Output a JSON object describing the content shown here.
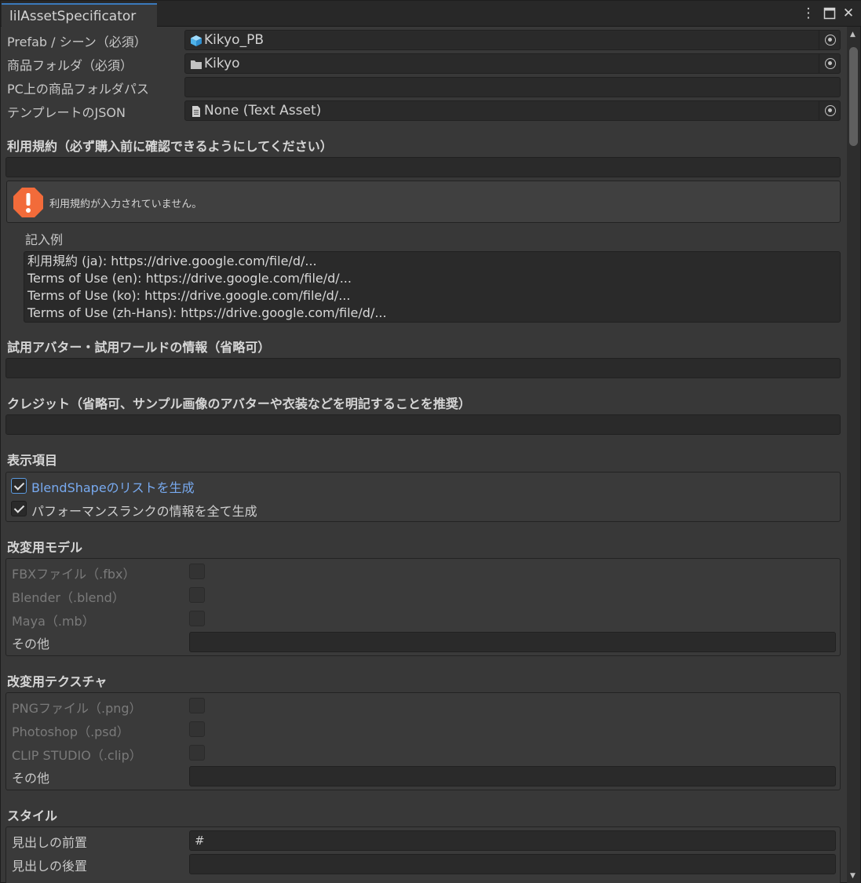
{
  "window": {
    "tab_title": "lilAssetSpecificator",
    "menu_glyph": "⋮",
    "maximize_glyph": "□",
    "close_glyph": "✕"
  },
  "fields": {
    "prefab_label": "Prefab / シーン（必須）",
    "prefab_value": "Kikyo_PB",
    "product_folder_label": "商品フォルダ（必須）",
    "product_folder_value": "Kikyo",
    "pc_path_label": "PC上の商品フォルダパス",
    "pc_path_value": "",
    "template_label": "テンプレートのJSON",
    "template_value": "None (Text Asset)"
  },
  "terms": {
    "title": "利用規約（必ず購入前に確認できるようにしてください）",
    "value": "",
    "warning": "利用規約が入力されていません。",
    "example_label": "記入例",
    "example_lines": [
      "利用規約 (ja): https://drive.google.com/file/d/...",
      "Terms of Use (en): https://drive.google.com/file/d/...",
      "Terms of Use (ko): https://drive.google.com/file/d/...",
      "Terms of Use (zh-Hans): https://drive.google.com/file/d/..."
    ]
  },
  "trial": {
    "title": "試用アバター・試用ワールドの情報（省略可）",
    "value": ""
  },
  "credit": {
    "title": "クレジット（省略可、サンプル画像のアバターや衣装などを明記することを推奨）",
    "value": ""
  },
  "display_items": {
    "title": "表示項目",
    "items": [
      {
        "label": "BlendShapeのリストを生成",
        "checked": true
      },
      {
        "label": "パフォーマンスランクの情報を全て生成",
        "checked": true
      }
    ]
  },
  "model": {
    "title": "改変用モデル",
    "items": [
      {
        "label": "FBXファイル（.fbx）",
        "checked": false
      },
      {
        "label": "Blender（.blend）",
        "checked": false
      },
      {
        "label": "Maya（.mb）",
        "checked": false
      }
    ],
    "other_label": "その他",
    "other_value": ""
  },
  "texture": {
    "title": "改変用テクスチャ",
    "items": [
      {
        "label": "PNGファイル（.png）",
        "checked": false
      },
      {
        "label": "Photoshop（.psd）",
        "checked": false
      },
      {
        "label": "CLIP STUDIO（.clip）",
        "checked": false
      }
    ],
    "other_label": "その他",
    "other_value": ""
  },
  "style": {
    "title": "スタイル",
    "heading_prefix_label": "見出しの前置",
    "heading_prefix_value": "#",
    "heading_suffix_label": "見出しの後置",
    "heading_suffix_value": ""
  },
  "colors": {
    "accent": "#3a79bb",
    "focus_text": "#78aaf0",
    "warning": "#f26b3a"
  }
}
